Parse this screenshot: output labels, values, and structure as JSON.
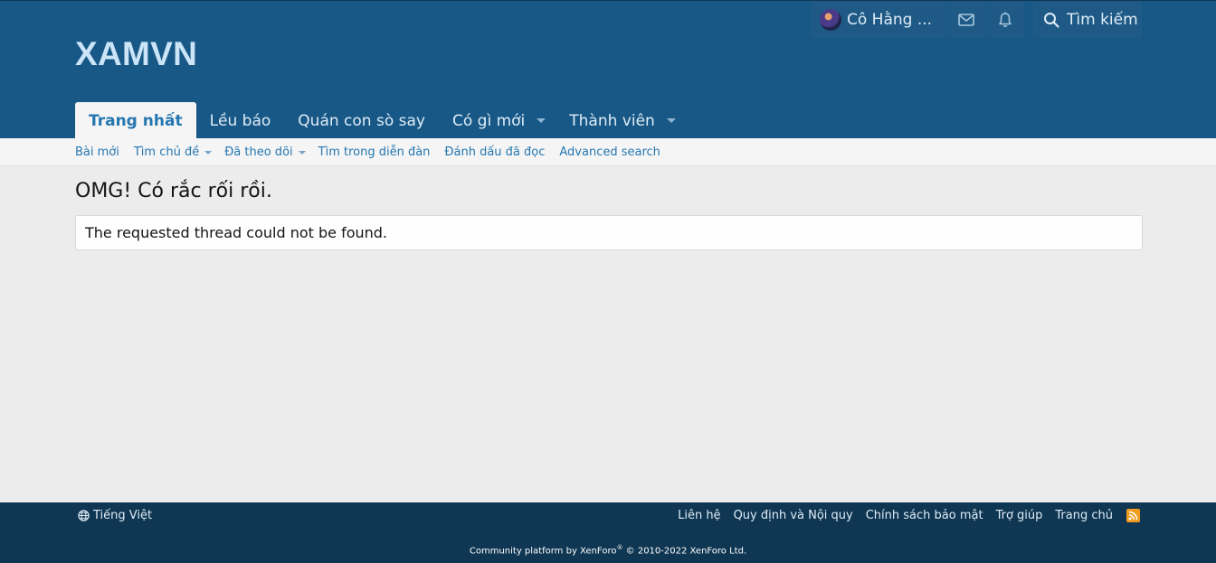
{
  "header": {
    "logo": "XAMVN"
  },
  "nav": {
    "tabs": [
      {
        "label": "Trang nhất",
        "selected": true,
        "dropdown": false
      },
      {
        "label": "Lều báo",
        "selected": false,
        "dropdown": false
      },
      {
        "label": "Quán con sò say",
        "selected": false,
        "dropdown": false
      },
      {
        "label": "Có gì mới",
        "selected": false,
        "dropdown": true
      },
      {
        "label": "Thành viên",
        "selected": false,
        "dropdown": true
      }
    ]
  },
  "user_nav": {
    "account_name": "Cô Hằng ...",
    "search_label": "Tìm kiếm"
  },
  "subnav": {
    "links": [
      {
        "label": "Bài mới",
        "dropdown": false
      },
      {
        "label": "Tìm chủ đề",
        "dropdown": true
      },
      {
        "label": "Đã theo dõi",
        "dropdown": true
      },
      {
        "label": "Tìm trong diễn đàn",
        "dropdown": false
      },
      {
        "label": "Đánh dấu đã đọc",
        "dropdown": false
      },
      {
        "label": "Advanced search",
        "dropdown": false
      }
    ]
  },
  "main": {
    "title": "OMG! Có rắc rối rồi.",
    "message": "The requested thread could not be found."
  },
  "footer": {
    "language": "Tiếng Việt",
    "links": [
      "Liên hệ",
      "Quy định và Nội quy",
      "Chính sách bảo mật",
      "Trợ giúp",
      "Trang chủ"
    ],
    "copyright_prefix": "Community platform by XenForo",
    "copyright_mark": "®",
    "copyright_suffix": " © 2010-2022 XenForo Ltd."
  },
  "colors": {
    "header_bg": "#185886",
    "footer_bg": "#0f3652",
    "link": "#2577b1",
    "rss": "#f29c1e"
  }
}
